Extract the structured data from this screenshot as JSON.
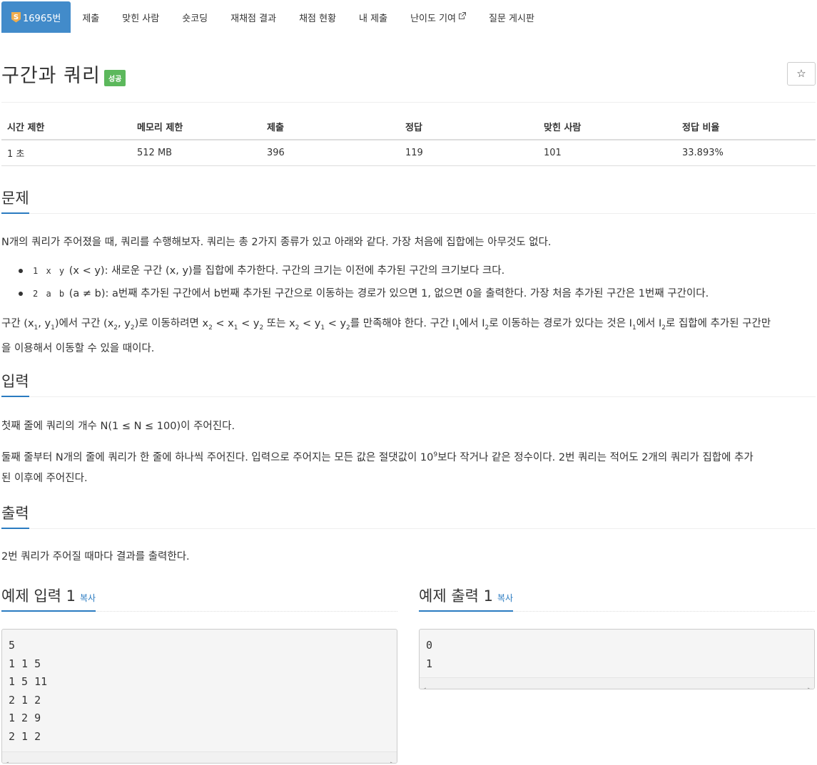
{
  "nav": {
    "problem_tab": "16965번",
    "problem_badge": "S",
    "tabs": [
      "제출",
      "맞힌 사람",
      "숏코딩",
      "재채점 결과",
      "채점 현황",
      "내 제출",
      "난이도 기여",
      "질문 게시판"
    ]
  },
  "problem": {
    "title": "구간과 쿼리",
    "status": "성공",
    "star": "☆"
  },
  "info": {
    "headers": [
      "시간 제한",
      "메모리 제한",
      "제출",
      "정답",
      "맞힌 사람",
      "정답 비율"
    ],
    "values": [
      "1 초",
      "512 MB",
      "396",
      "119",
      "101",
      "33.893%"
    ]
  },
  "sections": {
    "problem": "문제",
    "input": "입력",
    "output": "출력",
    "sample_input": "예제 입력 1",
    "sample_output": "예제 출력 1",
    "copy": "복사"
  },
  "statement": {
    "intro": "N개의 쿼리가 주어졌을 때, 쿼리를 수행해보자. 쿼리는 총 2가지 종류가 있고 아래와 같다. 가장 처음에 집합에는 아무것도 없다.",
    "q1_code": "1 x y",
    "q1_text": "(x < y): 새로운 구간 (x, y)를 집합에 추가한다. 구간의 크기는 이전에 추가된 구간의 크기보다 크다.",
    "q2_code": "2 a b",
    "q2_text": "(a ≠ b): a번째 추가된 구간에서 b번째 추가된 구간으로 이동하는 경로가 있으면 1, 없으면 0을 출력한다. 가장 처음 추가된 구간은 1번째 구간이다.",
    "rule_line2": "을 이용해서 이동할 수 있을 때이다."
  },
  "input_desc": {
    "line1": "첫째 줄에 쿼리의 개수 N(1 ≤ N ≤ 100)이 주어진다.",
    "line2a": "둘째 줄부터 N개의 줄에 쿼리가 한 줄에 하나씩 주어진다. 입력으로 주어지는 모든 값은 절댓값이 10",
    "line2b": "보다 작거나 같은 정수이다. 2번 쿼리는 적어도 2개의 쿼리가 집합에 추가",
    "line3": "된 이후에 주어진다."
  },
  "output_desc": "2번 쿼리가 주어질 때마다 결과를 출력한다.",
  "sample_input": [
    "5",
    "1 1 5",
    "1 5 11",
    "2 1 2",
    "1 2 9",
    "2 1 2"
  ],
  "sample_output": [
    "0",
    "1"
  ]
}
